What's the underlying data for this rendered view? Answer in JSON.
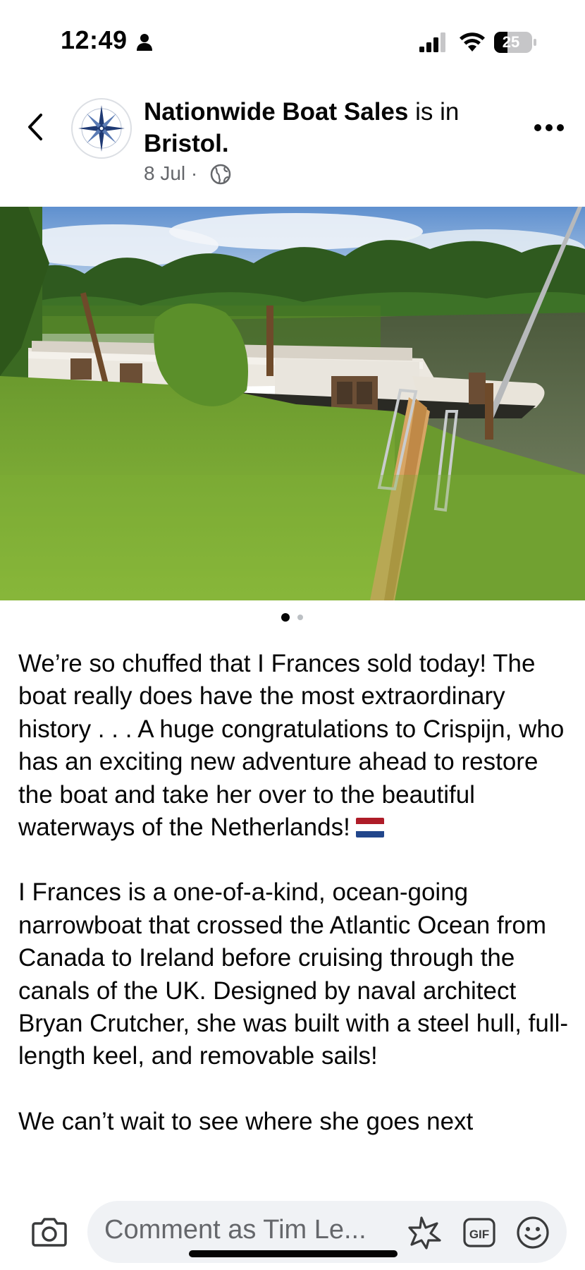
{
  "status_bar": {
    "time": "12:49",
    "battery": "25",
    "icons": [
      "person-icon",
      "signal-icon",
      "wifi-icon",
      "battery-icon"
    ]
  },
  "post": {
    "page_name": "Nationwide Boat Sales",
    "location_prefix": " is in ",
    "location": "Bristol",
    "location_suffix": ".",
    "date": "8 Jul",
    "separator": " · ",
    "privacy_icon": "globe-icon",
    "photo_count": 2,
    "photo_index": 1,
    "paragraphs": [
      "We’re so chuffed that I Frances sold today! The boat really does have the most extraordinary history . . . A huge congratulations to Crispijn, who has an exciting new adventure ahead to restore the boat and take her over to the beautiful waterways of the Netherlands!",
      "I Frances is a one-of-a-kind, ocean-going narrowboat that crossed the Atlantic Ocean from Canada to Ireland before cruising through the canals of the UK. Designed by naval architect Bryan Crutcher, she was built with a steel hull, full-length keel, and removable sails!",
      "We can’t wait to see where she goes next"
    ]
  },
  "comment_bar": {
    "placeholder": "Comment as Tim Le...",
    "gif_label": "GIF",
    "icons": [
      "camera-icon",
      "sticker-icon",
      "gif-icon",
      "emoji-icon"
    ]
  },
  "colors": {
    "text": "#050505",
    "secondary_text": "#65676b",
    "input_bg": "#f0f2f5",
    "flag": [
      "#ae1c28",
      "#ffffff",
      "#21468b"
    ]
  }
}
